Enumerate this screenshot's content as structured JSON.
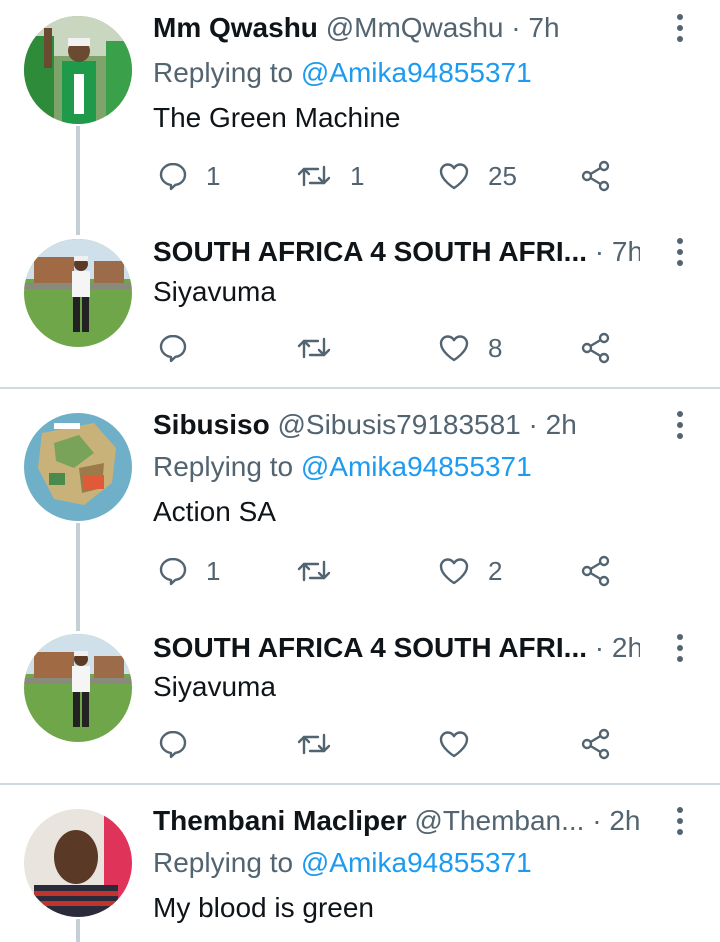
{
  "tweets": [
    {
      "name": "Mm Qwashu",
      "handle": "@MmQwashu",
      "dot": "·",
      "time": "7h",
      "replying_prefix": "Replying to",
      "replying_to": "@Amika94855371",
      "text": "The Green Machine",
      "replies": "1",
      "retweets": "1",
      "likes": "25"
    },
    {
      "name": "SOUTH AFRICA 4 SOUTH AFRI...",
      "handle": "",
      "dot": "·",
      "time": "7h",
      "text": "Siyavuma",
      "replies": "",
      "retweets": "",
      "likes": "8"
    },
    {
      "name": "Sibusiso",
      "handle": "@Sibusis79183581",
      "dot": "·",
      "time": "2h",
      "replying_prefix": "Replying to",
      "replying_to": "@Amika94855371",
      "text": "Action SA",
      "replies": "1",
      "retweets": "",
      "likes": "2"
    },
    {
      "name": "SOUTH AFRICA 4 SOUTH AFRI...",
      "handle": "",
      "dot": "·",
      "time": "2h",
      "text": "Siyavuma",
      "replies": "",
      "retweets": "",
      "likes": ""
    },
    {
      "name": "Thembani Macliper",
      "handle": "@Themban...",
      "dot": "·",
      "time": "2h",
      "replying_prefix": "Replying to",
      "replying_to": "@Amika94855371",
      "text": "My blood is green"
    }
  ],
  "colors": {
    "text": "#0f1419",
    "secondary": "#536471",
    "link": "#1d9bf0",
    "thread_line": "#c4cfd6",
    "separator": "#cfd9de"
  },
  "icons": {
    "reply": "reply-icon",
    "retweet": "retweet-icon",
    "like": "heart-icon",
    "share": "share-icon",
    "more": "more-vertical-icon"
  }
}
